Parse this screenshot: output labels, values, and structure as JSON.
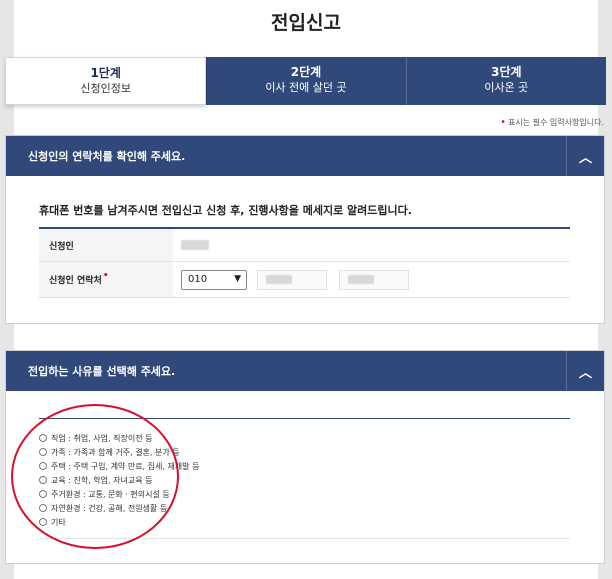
{
  "page": {
    "title": "전입신고"
  },
  "steps": [
    {
      "num": "1단계",
      "label": "신청인정보"
    },
    {
      "num": "2단계",
      "label": "이사 전에 살던 곳"
    },
    {
      "num": "3단계",
      "label": "이사온 곳"
    }
  ],
  "required_note": "표시는 필수 입력사항입니다.",
  "contact_section": {
    "heading": "신청인의 연락처를 확인해 주세요.",
    "intro": "휴대폰 번호를 남겨주시면 전입신고 신청 후, 진행사항을 메세지로 알려드립니다.",
    "applicant_label": "신청인",
    "phone_label": "신청인 연락처",
    "phone_prefix": "010"
  },
  "reason_section": {
    "heading": "전입하는 사유를 선택해 주세요.",
    "options": [
      "직업 : 취업, 사업, 직장이전 등",
      "가족 : 가족과 함께 거주, 결혼, 분가 등",
      "주택 : 주택 구입, 계약 만료, 집세, 재개발 등",
      "교육 : 진학, 학업, 자녀교육 등",
      "주거환경 : 교통, 문화 · 편의시설 등",
      "자연환경 : 건강, 공해, 전원생활 등",
      "기타"
    ]
  },
  "colors": {
    "primary": "#31497a",
    "highlight": "#d6102b"
  },
  "icons": {
    "toggle": "chevron-up-icon",
    "select": "chevron-down-icon"
  }
}
